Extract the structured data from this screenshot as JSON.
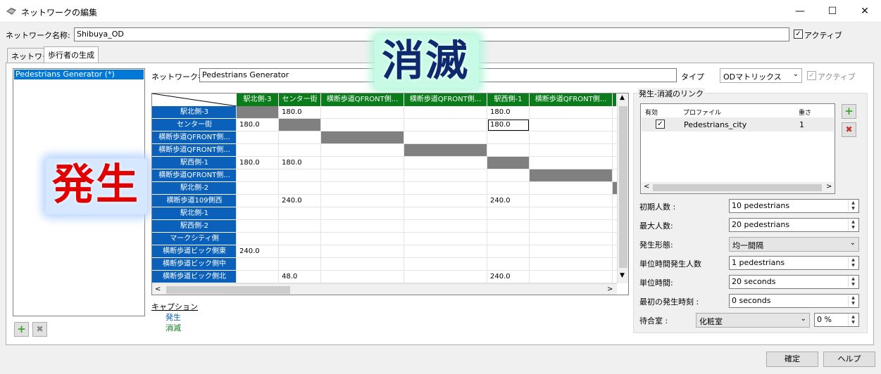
{
  "window": {
    "title": "ネットワークの編集"
  },
  "network": {
    "name_label": "ネットワーク名称:",
    "name_value": "Shibuya_OD",
    "active_label": "アクティブ"
  },
  "tabs": [
    {
      "label": "ネットワーク"
    },
    {
      "label": "歩行者の生成"
    }
  ],
  "generators": {
    "items": [
      "Pedestrians Generator (*)"
    ]
  },
  "generator": {
    "name_label": "ネットワーク名称:",
    "name_value": "Pedestrians Generator",
    "type_label": "タイプ",
    "type_value": "ODマトリックス",
    "active_label": "アクティブ"
  },
  "overlay": {
    "generation": "発生",
    "extinction": "消滅"
  },
  "matrix": {
    "columns": [
      "駅北側-3",
      "センター街",
      "横断歩道QFRONT側...",
      "横断歩道QFRONT側...",
      "駅西側-1",
      "横断歩道QFRONT側..."
    ],
    "rows": [
      {
        "label": "駅北側-3",
        "cells": [
          "",
          "180.0",
          "",
          "",
          "180.0",
          ""
        ]
      },
      {
        "label": "センター街",
        "cells": [
          "180.0",
          "",
          "",
          "",
          "180.0",
          ""
        ]
      },
      {
        "label": "横断歩道QFRONT側...",
        "cells": [
          "",
          "",
          "",
          "",
          "",
          ""
        ]
      },
      {
        "label": "横断歩道QFRONT側...",
        "cells": [
          "",
          "",
          "",
          "",
          "",
          ""
        ]
      },
      {
        "label": "駅西側-1",
        "cells": [
          "180.0",
          "180.0",
          "",
          "",
          "",
          ""
        ]
      },
      {
        "label": "横断歩道QFRONT側...",
        "cells": [
          "",
          "",
          "",
          "",
          "",
          ""
        ]
      },
      {
        "label": "駅北側-2",
        "cells": [
          "",
          "",
          "",
          "",
          "",
          ""
        ]
      },
      {
        "label": "横断歩道109側西",
        "cells": [
          "",
          "240.0",
          "",
          "",
          "240.0",
          ""
        ]
      },
      {
        "label": "駅北側-1",
        "cells": [
          "",
          "",
          "",
          "",
          "",
          ""
        ]
      },
      {
        "label": "駅西側-2",
        "cells": [
          "",
          "",
          "",
          "",
          "",
          ""
        ]
      },
      {
        "label": "マークシティ側",
        "cells": [
          "",
          "",
          "",
          "",
          "",
          ""
        ]
      },
      {
        "label": "横断歩道ビック側東",
        "cells": [
          "240.0",
          "",
          "",
          "",
          "",
          ""
        ]
      },
      {
        "label": "横断歩道ビック側中",
        "cells": [
          "",
          "",
          "",
          "",
          "",
          ""
        ]
      },
      {
        "label": "横断歩道ビック側北",
        "cells": [
          "",
          "48.0",
          "",
          "",
          "240.0",
          ""
        ]
      }
    ]
  },
  "caption": {
    "title": "キャプション",
    "generation": "発生",
    "extinction": "消滅"
  },
  "links": {
    "group_title": "発生-消滅のリンク",
    "headers": [
      "有効",
      "プロファイル",
      "重さ"
    ],
    "rows": [
      {
        "enabled": true,
        "profile": "Pedestrians_city",
        "weight": "1"
      }
    ]
  },
  "fields": {
    "initial_label": "初期人数 :",
    "initial_value": "10 pedestrians",
    "max_label": "最大人数:",
    "max_value": "20 pedestrians",
    "pattern_label": "発生形態:",
    "pattern_value": "均一間隔",
    "per_unit_label": "単位時間発生人数",
    "per_unit_value": "1 pedestrians",
    "unit_time_label": "単位時間:",
    "unit_time_value": "20 seconds",
    "first_time_label": "最初の発生時刻 :",
    "first_time_value": "0 seconds",
    "waiting_label": "待合室 :",
    "waiting_value": "化粧室",
    "waiting_pct": "0 %"
  },
  "buttons": {
    "ok": "確定",
    "help": "ヘルプ"
  }
}
